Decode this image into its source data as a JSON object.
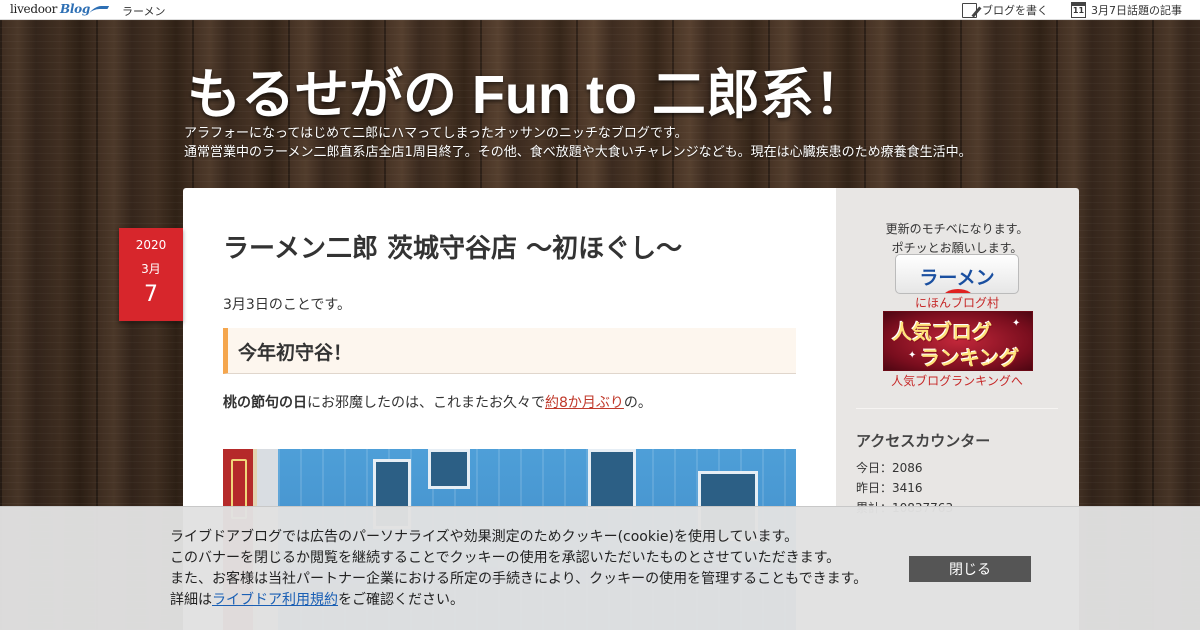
{
  "topbar": {
    "logo_text": "livedoor",
    "logo_blog": "Blog",
    "category": "ラーメン",
    "write_label": "ブログを書く",
    "calendar_day": "11",
    "today_label": "3月7日話題の記事"
  },
  "blog": {
    "title": "もるせがの Fun to 二郎系！",
    "desc_line1": "アラフォーになってはじめて二郎にハマってしまったオッサンのニッチなブログです。",
    "desc_line2": "通常営業中のラーメン二郎直系店全店1周目終了。その他、食べ放題や大食いチャレンジなども。現在は心臓疾患のため療養食生活中。"
  },
  "date": {
    "year": "2020",
    "month": "3月",
    "day": "7"
  },
  "article": {
    "title": "ラーメン二郎 茨城守谷店 〜初ほぐし〜",
    "lead": "3月3日のことです。",
    "heading": "今年初守谷！",
    "para_bold": "桃の節句の日",
    "para_mid": "にお邪魔したのは、これまたお久々で",
    "para_link": "約8か月ぶり",
    "para_end": "の。"
  },
  "sidebar": {
    "note_line1": "更新のモチベになります。",
    "note_line2": "ポチッとお願いします。",
    "ramen_button": "ラーメン",
    "nihon_link": "にほんブログ村",
    "rank_banner_line1": "人気ブログ",
    "rank_banner_line2": "ランキング",
    "rank_link": "人気ブログランキングへ",
    "counter_heading": "アクセスカウンター",
    "today_count": "今日：2086",
    "yesterday_count": "昨日：3416",
    "total_count": "累計：10837763"
  },
  "cookie": {
    "line1": "ライブドアブログでは広告のパーソナライズや効果測定のためクッキー(cookie)を使用しています。",
    "line2": "このバナーを閉じるか閲覧を継続することでクッキーの使用を承認いただいたものとさせていただきます。",
    "line3": "また、お客様は当社パートナー企業における所定の手続きにより、クッキーの使用を管理することもできます。",
    "line4_prefix": "詳細は",
    "line4_link": "ライブドア利用規約",
    "line4_suffix": "をご確認ください。",
    "close_label": "閉じる"
  },
  "colors": {
    "date_badge": "#d7262c",
    "heading_accent": "#f5a64d",
    "link": "#c0392b",
    "cookie_button": "#555555"
  }
}
